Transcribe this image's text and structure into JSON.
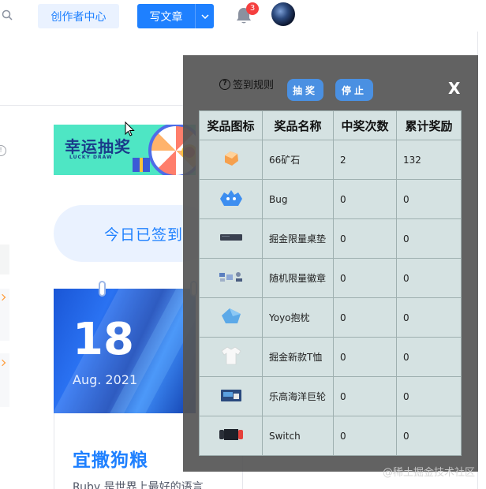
{
  "header": {
    "creator_label": "创作者中心",
    "write_label": "写文章",
    "notification_count": "3"
  },
  "checkin": {
    "lucky_title": "幸运抽奖",
    "lucky_sub": "LUCKY DRAW",
    "signed_label": "今日已签到",
    "day": "18",
    "month": "Aug. 2021"
  },
  "post": {
    "title": "宜撒狗粮",
    "desc": "Ruby 是世界上最好的语言"
  },
  "modal": {
    "rules_label": "签到规则",
    "draw_label": "抽奖",
    "stop_label": "停止",
    "close_label": "X",
    "columns": [
      "奖品图标",
      "奖品名称",
      "中奖次数",
      "累计奖励"
    ],
    "prizes": [
      {
        "icon": "ore-icon",
        "name": "66矿石",
        "times": "2",
        "total": "132"
      },
      {
        "icon": "bug-icon",
        "name": "Bug",
        "times": "0",
        "total": "0"
      },
      {
        "icon": "desk-mat-icon",
        "name": "掘金限量桌垫",
        "times": "0",
        "total": "0"
      },
      {
        "icon": "badge-icon",
        "name": "随机限量徽章",
        "times": "0",
        "total": "0"
      },
      {
        "icon": "pillow-icon",
        "name": "Yoyo抱枕",
        "times": "0",
        "total": "0"
      },
      {
        "icon": "tshirt-icon",
        "name": "掘金新款T恤",
        "times": "0",
        "total": "0"
      },
      {
        "icon": "lego-ship-icon",
        "name": "乐高海洋巨轮",
        "times": "0",
        "total": "0"
      },
      {
        "icon": "switch-icon",
        "name": "Switch",
        "times": "0",
        "total": "0"
      }
    ]
  },
  "watermark": "@稀土掘金技术社区",
  "colors": {
    "brand_blue": "#1e80ff",
    "modal_button": "#4a90e2",
    "modal_overlay": "#555555",
    "table_bg": "#d5e2e2"
  }
}
